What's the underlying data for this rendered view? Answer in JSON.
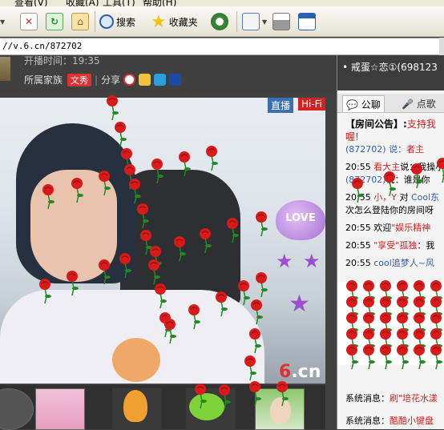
{
  "menubar": {
    "items": [
      "查看(V)",
      "收藏(A)",
      "工具(T)",
      "帮助(H)"
    ]
  },
  "toolbar": {
    "search_label": "搜索",
    "favorites_label": "收藏夹"
  },
  "address": {
    "url": "//v.6.cn/872702"
  },
  "room": {
    "start_time_label": "开播时间：19:35",
    "family_label": "所属家族",
    "family_badge": "文秀",
    "share_label": "分享"
  },
  "video": {
    "live_tag": "直播",
    "hifi_tag": "Hi-Fi",
    "love_sticker": "LOVE",
    "logo_6": "6",
    "logo_cn": ".cn"
  },
  "right": {
    "top_user": "戒蛋☆恋①(698123",
    "tab_chat": "公聊",
    "tab_song": "点歌",
    "announcement_label": "【房间公告】:",
    "announcement_text": "支持我",
    "announcement_text2": "喔!",
    "messages": [
      {
        "line1_pre": "(872702) 说：",
        "line1_post": "者主"
      },
      {
        "time": "20:55",
        "name": "看大主",
        "text": "说：我操小"
      },
      {
        "id": "(872702)",
        "text": "说：谁是你"
      },
      {
        "time": "20:55",
        "name": "小，Y",
        "mid": "对",
        "target": "Cool东"
      },
      {
        "text": "次怎么登陆你的房间呀"
      },
      {
        "time": "20:55",
        "pre": "欢迎",
        "name": "\"娱乐精神"
      },
      {
        "time": "20:55",
        "name": "\"享受\"孤独",
        "text": "：我"
      },
      {
        "time": "20:55",
        "name": "cool追梦人~风"
      }
    ],
    "system_messages": [
      {
        "label": "系统消息：",
        "text": "刷\"培花水漾"
      },
      {
        "label": "系统消息：",
        "text": "酷酷小键盘"
      }
    ]
  },
  "colors": {
    "rose": "#d81a1a",
    "leaf": "#1f8a1f",
    "accent_red": "#d42222",
    "live_blue": "#3a6fb2"
  }
}
